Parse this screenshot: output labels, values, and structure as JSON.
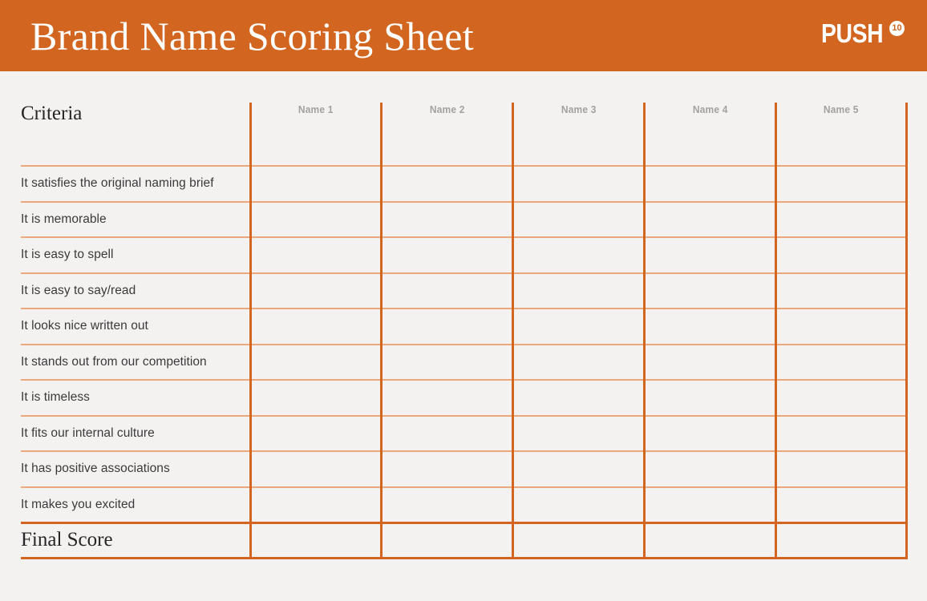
{
  "header": {
    "title": "Brand Name Scoring Sheet",
    "background_color": "#d2651f",
    "title_color": "#ffffff",
    "logo": {
      "wordmark": "PUSH",
      "badge": "10"
    }
  },
  "page": {
    "background_color": "#f4f2f1",
    "accent_color": "#d2651f",
    "rule_color": "#e9a97c"
  },
  "table": {
    "criteria_header": "Criteria",
    "final_score_label": "Final Score",
    "name_columns": [
      {
        "label": "Name 1"
      },
      {
        "label": "Name 2"
      },
      {
        "label": "Name 3"
      },
      {
        "label": "Name 4"
      },
      {
        "label": "Name 5"
      }
    ],
    "criteria": [
      {
        "label": "It satisfies the original naming brief"
      },
      {
        "label": "It is memorable"
      },
      {
        "label": "It is easy to spell"
      },
      {
        "label": "It is easy to say/read"
      },
      {
        "label": "It looks nice written out"
      },
      {
        "label": "It stands out from our competition"
      },
      {
        "label": "It is timeless"
      },
      {
        "label": "It fits our internal culture"
      },
      {
        "label": "It has positive associations"
      },
      {
        "label": "It makes you excited"
      }
    ],
    "scores": [
      [
        "",
        "",
        "",
        "",
        ""
      ],
      [
        "",
        "",
        "",
        "",
        ""
      ],
      [
        "",
        "",
        "",
        "",
        ""
      ],
      [
        "",
        "",
        "",
        "",
        ""
      ],
      [
        "",
        "",
        "",
        "",
        ""
      ],
      [
        "",
        "",
        "",
        "",
        ""
      ],
      [
        "",
        "",
        "",
        "",
        ""
      ],
      [
        "",
        "",
        "",
        "",
        ""
      ],
      [
        "",
        "",
        "",
        "",
        ""
      ],
      [
        "",
        "",
        "",
        "",
        ""
      ]
    ],
    "final_scores": [
      "",
      "",
      "",
      "",
      ""
    ]
  }
}
